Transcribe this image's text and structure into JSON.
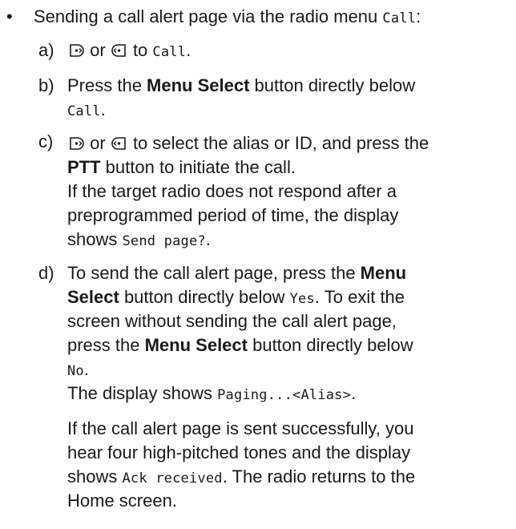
{
  "bullet_symbol": "•",
  "intro": {
    "text": "Sending a call alert page via the radio menu ",
    "menu_item": "Call",
    "colon": ":"
  },
  "steps": {
    "a": {
      "label": "a)",
      "or": "or",
      "to": "to",
      "target": "Call",
      "period": "."
    },
    "b": {
      "label": "b)",
      "pre": "Press the ",
      "button": "Menu Select",
      "post": " button directly below",
      "target": "Call",
      "period": "."
    },
    "c": {
      "label": "c)",
      "or": "or",
      "rest": "to select the alias or ID, and press the",
      "button": "PTT",
      "post": " button to initiate the call.",
      "note_line1": "If the target radio does not respond after a",
      "note_line2": "preprogrammed period of time, the display",
      "note_line3_pre": "shows ",
      "note_line3_mono": "Send page?",
      "period": "."
    },
    "d": {
      "label": "d)",
      "line1_pre": "To send the call alert page, press the ",
      "line1_bold": "Menu",
      "line2_bold": "Select",
      "line2_post": " button directly below ",
      "line2_mono": "Yes",
      "line2_end": ". To exit the",
      "line3": "screen without sending the call alert page,",
      "line4_pre": "press the ",
      "line4_bold": "Menu Select",
      "line4_post": " button directly below",
      "line5_mono": "No",
      "line5_end": ".",
      "line6_pre": "The display shows ",
      "line6_mono": "Paging...<Alias>",
      "line6_end": "."
    },
    "result": {
      "line1": "If the call alert page is sent successfully, you",
      "line2": "hear four high-pitched tones and the display",
      "line3_pre": "shows ",
      "line3_mono": "Ack received",
      "line3_post": ". The radio returns to the",
      "line4": "Home screen."
    }
  },
  "icons": {
    "nav_right": "nav-right-icon",
    "nav_left": "nav-left-icon"
  }
}
